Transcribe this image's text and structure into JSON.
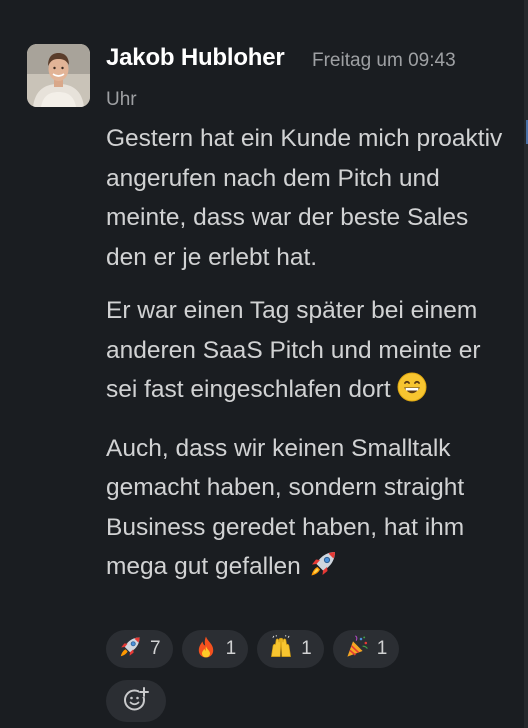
{
  "message": {
    "author": "Jakob Hubloher",
    "timestamp_line1": "Freitag um 09:43",
    "timestamp_line2": "Uhr",
    "paragraphs": [
      "Gestern hat ein Kunde mich proaktiv angerufen nach dem Pitch und meinte, dass war der beste Sales den er je erlebt hat.",
      "Er war einen Tag später bei einem anderen SaaS Pitch und meinte er sei fast eingeschlafen dort",
      "Auch, dass wir keinen Smalltalk gemacht haben, sondern straight Business geredet haben, hat ihm mega gut gefallen"
    ],
    "paragraph_emojis": [
      "",
      "grinning-face-icon",
      "rocket-icon"
    ]
  },
  "reactions": [
    {
      "icon": "rocket-icon",
      "count": "7"
    },
    {
      "icon": "fire-icon",
      "count": "1"
    },
    {
      "icon": "raising-hands-icon",
      "count": "1"
    },
    {
      "icon": "party-popper-icon",
      "count": "1"
    }
  ],
  "add_reaction": {
    "icon": "add-emoji-icon"
  },
  "colors": {
    "background": "#1a1d21",
    "author": "#ffffff",
    "text": "#d1d2d3",
    "muted": "#9ea0a3",
    "pill": "#2b2e33"
  }
}
